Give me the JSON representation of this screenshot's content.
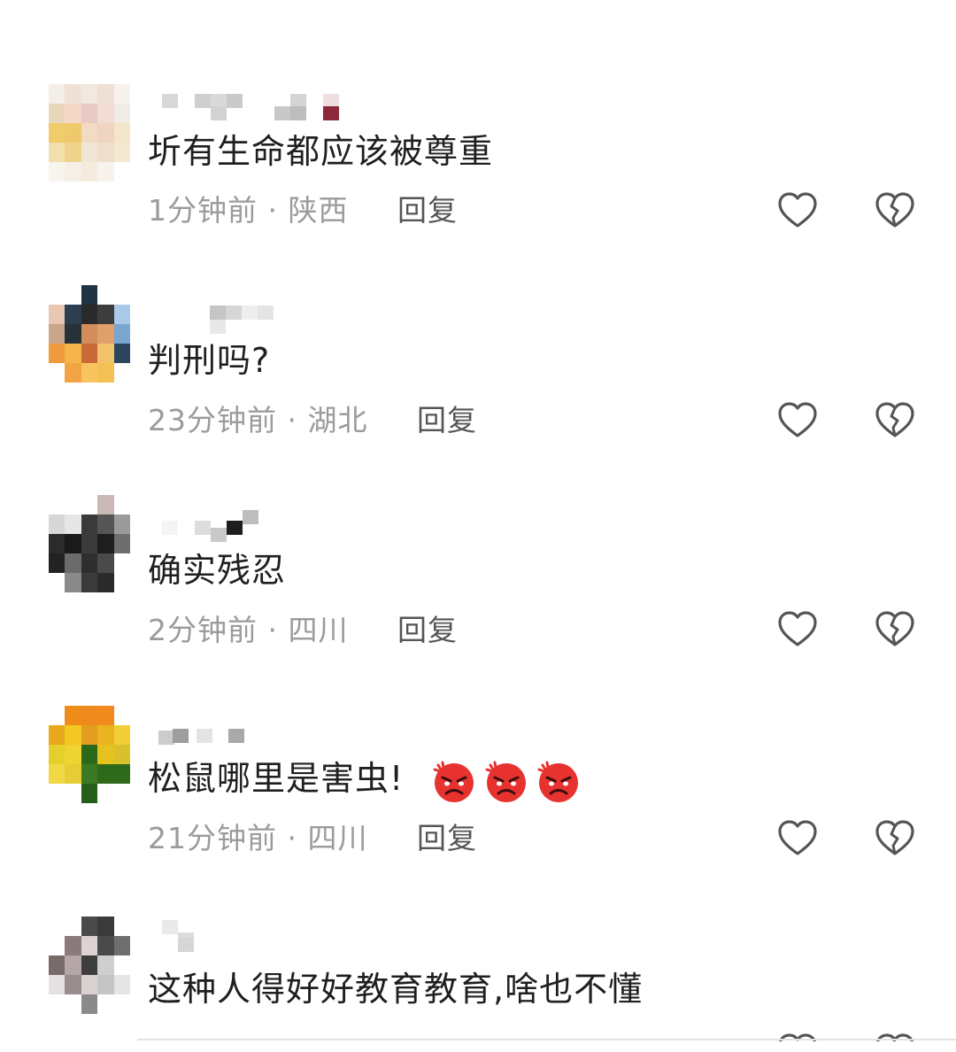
{
  "comments": [
    {
      "text": "圻有生命都应该被尊重",
      "time": "1分钟前",
      "location": "陕西",
      "reply_label": "回复",
      "emoji": []
    },
    {
      "text": "判刑吗?",
      "time": "23分钟前",
      "location": "湖北",
      "reply_label": "回复",
      "emoji": []
    },
    {
      "text": "确实残忍",
      "time": "2分钟前",
      "location": "四川",
      "reply_label": "回复",
      "emoji": []
    },
    {
      "text": "松鼠哪里是害虫!",
      "time": "21分钟前",
      "location": "四川",
      "reply_label": "回复",
      "emoji": [
        "angry-face-emoji",
        "angry-face-emoji",
        "angry-face-emoji"
      ]
    },
    {
      "text": "这种人得好好教育教育,啥也不懂",
      "time": "",
      "location": "",
      "reply_label": "",
      "emoji": []
    }
  ],
  "meta_separator": "·",
  "icons": {
    "like": "heart-icon",
    "dislike": "broken-heart-icon"
  },
  "colors": {
    "text": "#1f1f1f",
    "meta": "#9b9b9b",
    "reply": "#555555",
    "icon_stroke": "#555555",
    "emoji_red": "#e8322f"
  }
}
